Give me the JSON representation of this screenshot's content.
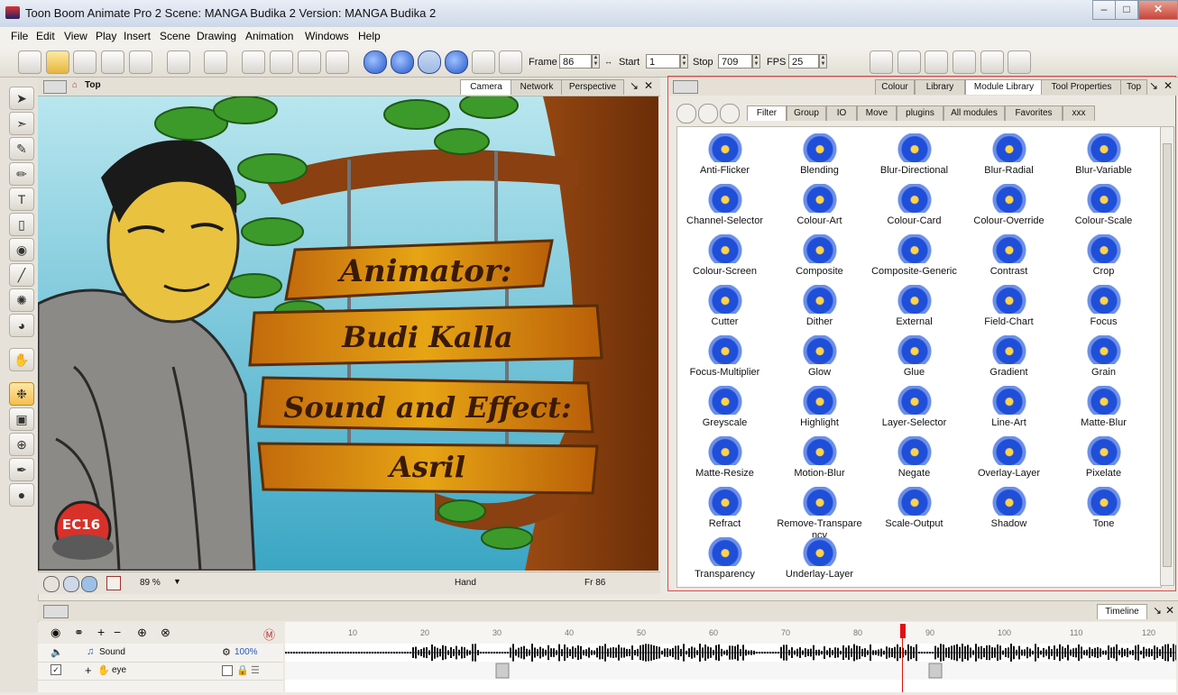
{
  "window": {
    "title": "Toon Boom Animate Pro 2 Scene: MANGA Budika 2 Version: MANGA Budika 2"
  },
  "menu": [
    "File",
    "Edit",
    "View",
    "Play",
    "Insert",
    "Scene",
    "Drawing",
    "Animation",
    "Windows",
    "Help"
  ],
  "playback": {
    "frame_label": "Frame",
    "frame": "86",
    "start_label": "Start",
    "start": "1",
    "stop_label": "Stop",
    "stop": "709",
    "fps_label": "FPS",
    "fps": "25"
  },
  "camera_view": {
    "breadcrumb": "Top",
    "tabs": [
      "Camera",
      "Network",
      "Perspective"
    ],
    "sign": {
      "line1": "Animator:",
      "line2": "Budi Kalla",
      "line3": "Sound and Effect:",
      "line4": "Asril"
    },
    "logo_text": "EC16",
    "zoom": "89 %",
    "tool": "Hand",
    "frame": "Fr 86"
  },
  "module_library": {
    "tabs": [
      "Colour",
      "Library",
      "Module Library",
      "Tool Properties",
      "Top"
    ],
    "filters": [
      "Filter",
      "Group",
      "IO",
      "Move",
      "plugins",
      "All modules",
      "Favorites",
      "xxx"
    ],
    "modules": [
      "Anti-Flicker",
      "Blending",
      "Blur-Directional",
      "Blur-Radial",
      "Blur-Variable",
      "Channel-Selector",
      "Colour-Art",
      "Colour-Card",
      "Colour-Override",
      "Colour-Scale",
      "Colour-Screen",
      "Composite",
      "Composite-Generic",
      "Contrast",
      "Crop",
      "Cutter",
      "Dither",
      "External",
      "Field-Chart",
      "Focus",
      "Focus-Multiplier",
      "Glow",
      "Glue",
      "Gradient",
      "Grain",
      "Greyscale",
      "Highlight",
      "Layer-Selector",
      "Line-Art",
      "Matte-Blur",
      "Matte-Resize",
      "Motion-Blur",
      "Negate",
      "Overlay-Layer",
      "Pixelate",
      "Refract",
      "Remove-Transpare\nncy",
      "Scale-Output",
      "Shadow",
      "Tone",
      "Transparency",
      "Underlay-Layer"
    ]
  },
  "timeline": {
    "tab": "Timeline",
    "ticks": [
      "10",
      "20",
      "30",
      "40",
      "50",
      "60",
      "70",
      "80",
      "90",
      "100",
      "110",
      "120"
    ],
    "layers": [
      {
        "name": "Sound",
        "value": "100%"
      },
      {
        "name": "eye"
      }
    ]
  }
}
